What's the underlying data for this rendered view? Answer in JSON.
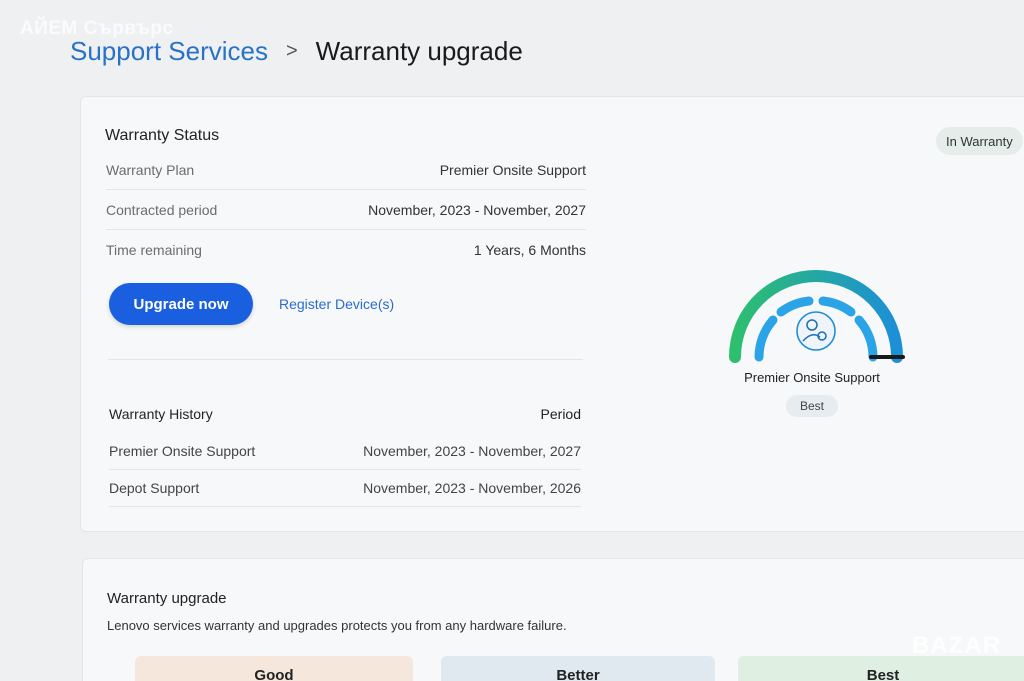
{
  "watermark": "АЙЕМ Сървърс",
  "breadcrumb": {
    "parent": "Support Services",
    "separator": ">",
    "current": "Warranty upgrade"
  },
  "warranty_status": {
    "title": "Warranty Status",
    "rows": [
      {
        "label": "Warranty Plan",
        "value": "Premier Onsite Support"
      },
      {
        "label": "Contracted period",
        "value": "November, 2023 - November, 2027"
      },
      {
        "label": "Time remaining",
        "value": "1 Years, 6 Months"
      }
    ],
    "upgrade_button": "Upgrade now",
    "register_link": "Register Device(s)",
    "status_badge": "In Warranty"
  },
  "gauge": {
    "plan_name": "Premier Onsite Support",
    "level_label": "Best",
    "level": 1.0,
    "colors": {
      "outer_start": "#2dbf6e",
      "outer_end": "#1c8fd8",
      "inner": "#2aa4e6"
    }
  },
  "warranty_history": {
    "header_label": "Warranty History",
    "header_period": "Period",
    "rows": [
      {
        "plan": "Premier Onsite Support",
        "period": "November, 2023 - November, 2027"
      },
      {
        "plan": "Depot Support",
        "period": "November, 2023 - November, 2026"
      }
    ]
  },
  "upgrade": {
    "title": "Warranty upgrade",
    "description": "Lenovo services warranty and upgrades protects you from any hardware failure.",
    "tiers": [
      "Good",
      "Better",
      "Best"
    ]
  },
  "bazar_watermark": "BAZAR"
}
